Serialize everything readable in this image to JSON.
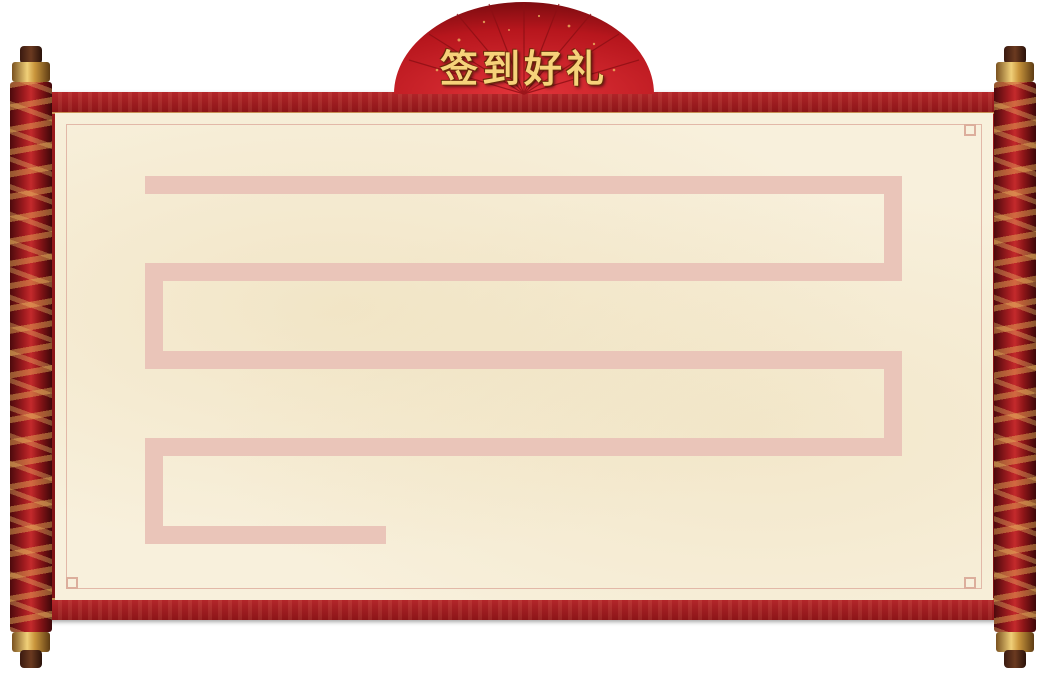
{
  "header": {
    "title": "签到好礼",
    "fan_icon": "red-folding-fan-icon"
  },
  "scroll": {
    "left_roller_icon": "dragon-scroll-roller-icon",
    "right_roller_icon": "dragon-scroll-roller-icon"
  },
  "colors": {
    "frame_red": "#9b1a1d",
    "paper": "#f8f0dc",
    "track": "#eac5b9",
    "title_gold": "#f6d27a"
  }
}
